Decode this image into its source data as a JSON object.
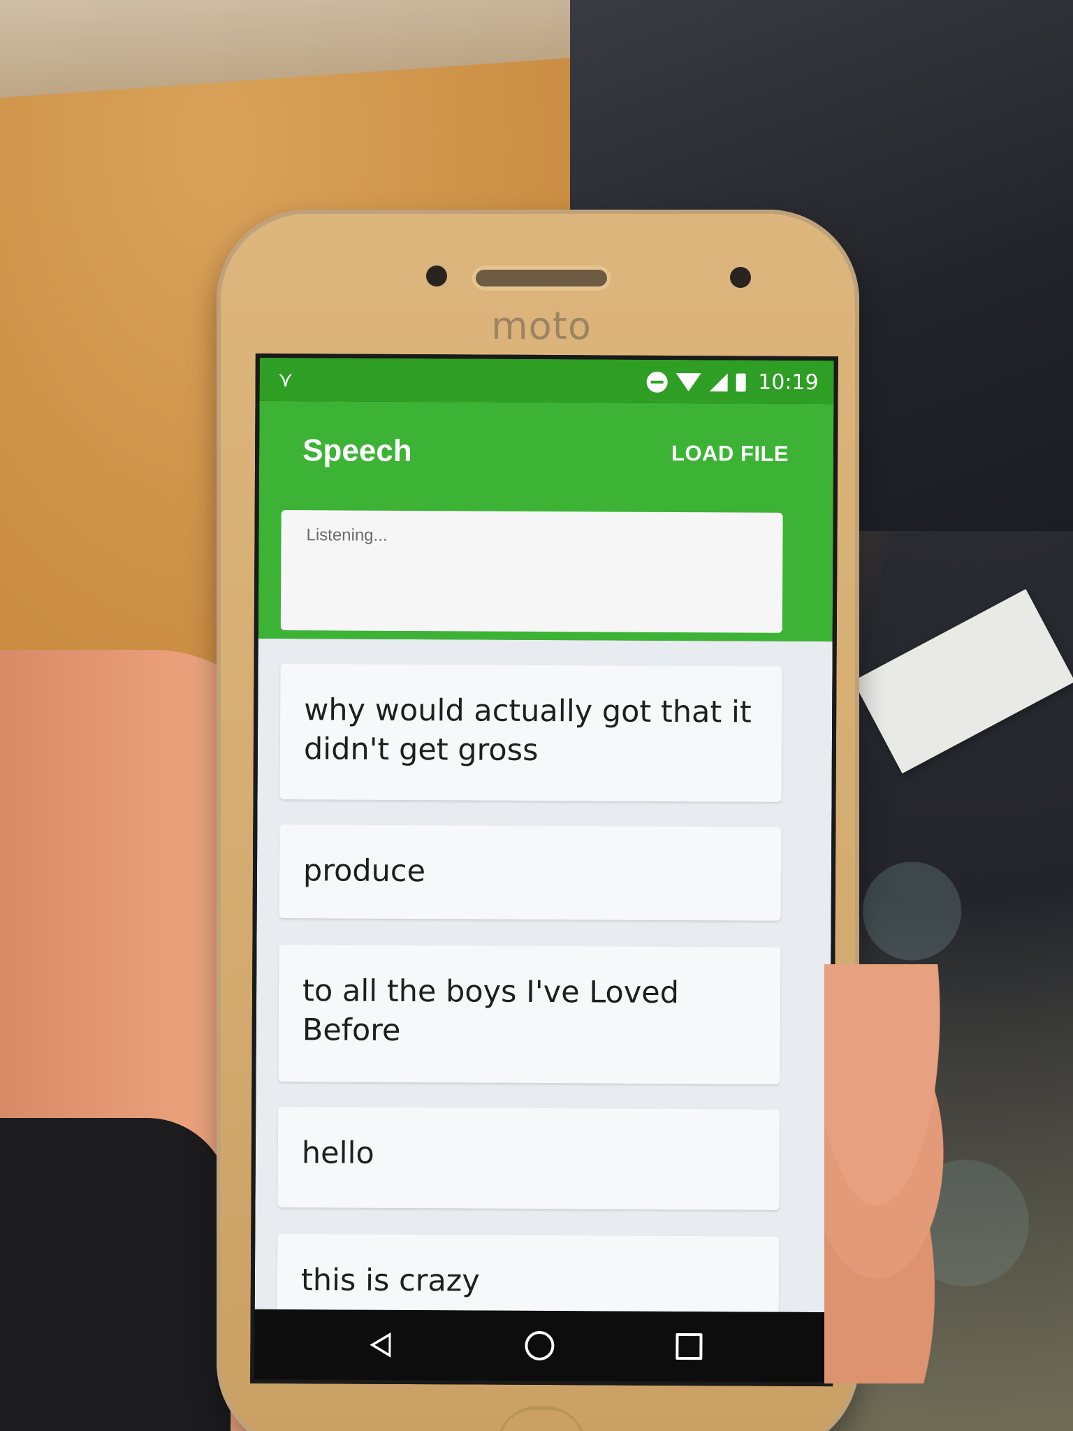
{
  "device": {
    "brand": "moto"
  },
  "status_bar": {
    "time": "10:19",
    "icons": [
      "notification-icon",
      "dnd-icon",
      "wifi-icon",
      "signal-icon",
      "battery-icon"
    ]
  },
  "app": {
    "title": "Speech",
    "load_file_label": "LOAD FILE",
    "listening_text": "Listening...",
    "accent_color": "#3cb335",
    "status_color": "#2f9e25"
  },
  "transcripts": [
    {
      "text": "why would actually got that it didn't get gross"
    },
    {
      "text": "produce"
    },
    {
      "text": "to all the boys I've Loved Before"
    },
    {
      "text": "hello"
    },
    {
      "text": "this is crazy"
    }
  ],
  "navigation": {
    "icons": [
      "back-icon",
      "home-icon",
      "recents-icon"
    ]
  }
}
